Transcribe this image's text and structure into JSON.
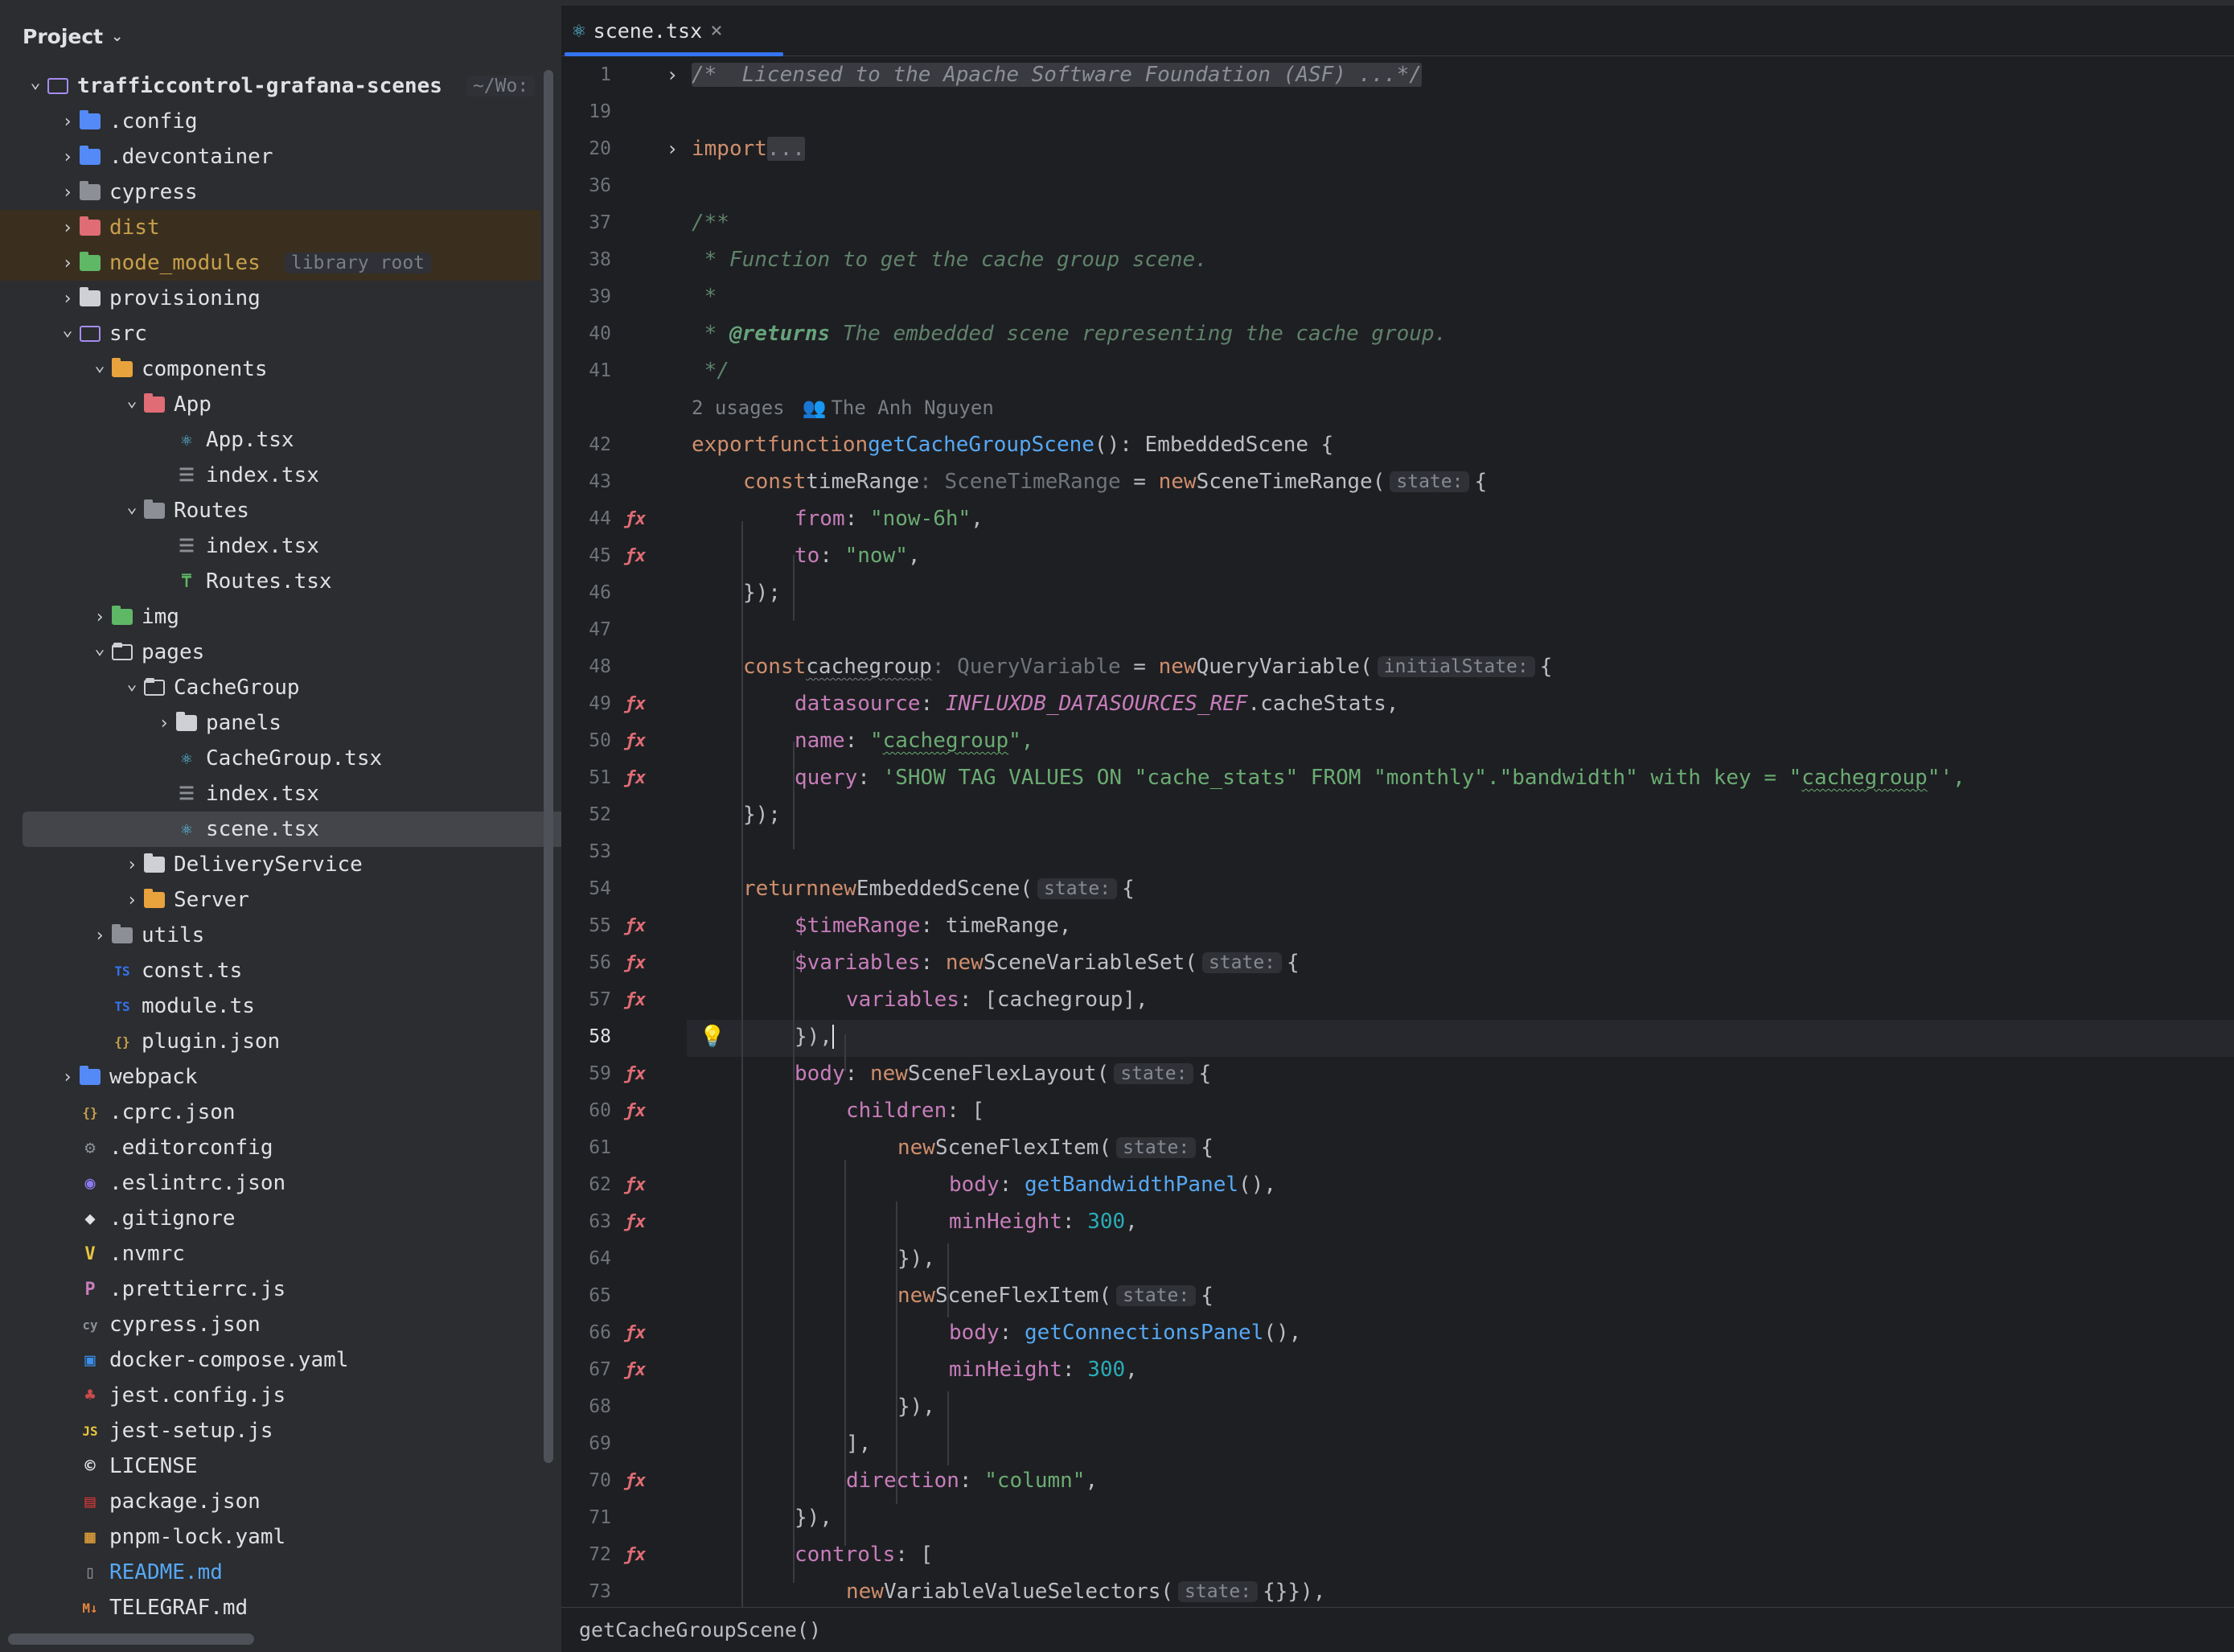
{
  "project_header": {
    "label": "Project"
  },
  "tree": [
    {
      "label": "trafficcontrol-grafana-scenes",
      "hint": "~/Wo:",
      "depth": 0,
      "expanded": true,
      "icon": "folder-outline-purple",
      "bold": true
    },
    {
      "label": ".config",
      "depth": 1,
      "expanded": false,
      "icon": "folder-blue-gear"
    },
    {
      "label": ".devcontainer",
      "depth": 1,
      "expanded": false,
      "icon": "folder-blue"
    },
    {
      "label": "cypress",
      "depth": 1,
      "expanded": false,
      "icon": "folder-gray"
    },
    {
      "label": "dist",
      "depth": 1,
      "expanded": false,
      "icon": "folder-red",
      "excluded": true
    },
    {
      "label": "node_modules",
      "hint": "library root",
      "depth": 1,
      "expanded": false,
      "icon": "folder-green",
      "excluded": true
    },
    {
      "label": "provisioning",
      "depth": 1,
      "expanded": false,
      "icon": "folder-white"
    },
    {
      "label": "src",
      "depth": 1,
      "expanded": true,
      "icon": "folder-source"
    },
    {
      "label": "components",
      "depth": 2,
      "expanded": true,
      "icon": "folder-orange"
    },
    {
      "label": "App",
      "depth": 3,
      "expanded": true,
      "icon": "folder-red"
    },
    {
      "label": "App.tsx",
      "depth": 4,
      "icon": "react-icon"
    },
    {
      "label": "index.tsx",
      "depth": 4,
      "icon": "index-icon"
    },
    {
      "label": "Routes",
      "depth": 3,
      "expanded": true,
      "icon": "folder-gray"
    },
    {
      "label": "index.tsx",
      "depth": 4,
      "icon": "index-icon"
    },
    {
      "label": "Routes.tsx",
      "depth": 4,
      "icon": "routes-icon"
    },
    {
      "label": "img",
      "depth": 2,
      "expanded": false,
      "icon": "folder-teal"
    },
    {
      "label": "pages",
      "depth": 2,
      "expanded": true,
      "icon": "folder-orange-outline"
    },
    {
      "label": "CacheGroup",
      "depth": 3,
      "expanded": true,
      "icon": "folder-outline"
    },
    {
      "label": "panels",
      "depth": 4,
      "expanded": false,
      "icon": "folder-white"
    },
    {
      "label": "CacheGroup.tsx",
      "depth": 4,
      "icon": "react-icon"
    },
    {
      "label": "index.tsx",
      "depth": 4,
      "icon": "index-icon"
    },
    {
      "label": "scene.tsx",
      "depth": 4,
      "icon": "react-icon",
      "selected": true
    },
    {
      "label": "DeliveryService",
      "depth": 3,
      "expanded": false,
      "icon": "folder-white"
    },
    {
      "label": "Server",
      "depth": 3,
      "expanded": false,
      "icon": "folder-orange"
    },
    {
      "label": "utils",
      "depth": 2,
      "expanded": false,
      "icon": "folder-gray"
    },
    {
      "label": "const.ts",
      "depth": 2,
      "icon": "ts-icon"
    },
    {
      "label": "module.ts",
      "depth": 2,
      "icon": "ts-icon"
    },
    {
      "label": "plugin.json",
      "depth": 2,
      "icon": "json-icon"
    },
    {
      "label": "webpack",
      "depth": 1,
      "expanded": false,
      "icon": "folder-blue"
    },
    {
      "label": ".cprc.json",
      "depth": 1,
      "icon": "json-icon"
    },
    {
      "label": ".editorconfig",
      "depth": 1,
      "icon": "editorconfig-icon"
    },
    {
      "label": ".eslintrc.json",
      "depth": 1,
      "icon": "eslint-icon"
    },
    {
      "label": ".gitignore",
      "depth": 1,
      "icon": "git-icon"
    },
    {
      "label": ".nvmrc",
      "depth": 1,
      "icon": "nvm-icon"
    },
    {
      "label": ".prettierrc.js",
      "depth": 1,
      "icon": "prettier-icon"
    },
    {
      "label": "cypress.json",
      "depth": 1,
      "icon": "cypress-icon"
    },
    {
      "label": "docker-compose.yaml",
      "depth": 1,
      "icon": "docker-icon"
    },
    {
      "label": "jest.config.js",
      "depth": 1,
      "icon": "jest-icon"
    },
    {
      "label": "jest-setup.js",
      "depth": 1,
      "icon": "js-icon"
    },
    {
      "label": "LICENSE",
      "depth": 1,
      "icon": "license-icon"
    },
    {
      "label": "package.json",
      "depth": 1,
      "icon": "npm-icon"
    },
    {
      "label": "pnpm-lock.yaml",
      "depth": 1,
      "icon": "pnpm-icon"
    },
    {
      "label": "README.md",
      "depth": 1,
      "icon": "readme-icon",
      "color": "#56a8f5"
    },
    {
      "label": "TELEGRAF.md",
      "depth": 1,
      "icon": "markdown-icon"
    }
  ],
  "editor_tab": {
    "label": "scene.tsx",
    "close": "×"
  },
  "breadcrumb": {
    "label": "getCacheGroupScene()"
  },
  "code": {
    "l1": "/*  Licensed to the Apache Software Foundation (ASF) ...*/",
    "l20_kw": "import",
    "l20_fold": "...",
    "l37": "/**",
    "l38": " * Function to get the cache group scene.",
    "l39": " *",
    "l40_a": " * ",
    "l40_tag": "@returns",
    "l40_b": " The embedded scene representing the cache group.",
    "l41": " */",
    "usages": "2 usages",
    "author": "The Anh Nguyen",
    "export": "export",
    "function": "function",
    "fn_name": "getCacheGroupScene",
    "fn_sig": "(): EmbeddedScene {",
    "const": "const",
    "timeRange": "timeRange",
    "SceneTimeRange_hint": ": SceneTimeRange",
    "eq": " = ",
    "new": "new",
    "SceneTimeRange": "SceneTimeRange(",
    "state_hint": "state:",
    "brace": "{",
    "from_key": "from",
    "from_val": "\"now-6h\"",
    "to_key": "to",
    "to_val": "\"now\"",
    "close_paren": "});",
    "cachegroup": "cachegroup",
    "QueryVariable_hint": ": QueryVariable",
    "QueryVariable": "QueryVariable(",
    "initialState_hint": "initialState:",
    "datasource_key": "datasource",
    "datasource_const": "INFLUXDB_DATASOURCES_REF",
    "datasource_rest": ".cacheStats,",
    "name_key": "name",
    "name_val_a": "\"",
    "name_val_b": "cachegroup",
    "name_val_c": "\",",
    "query_key": "query",
    "query_val_a": "'SHOW TAG VALUES ON \"cache_stats\" FROM \"monthly\".\"bandwidth\" with key = \"",
    "query_val_b": "cachegroup",
    "query_val_c": "\"',",
    "return": "return",
    "EmbeddedScene": "EmbeddedScene(",
    "timeRange_prop": "$timeRange",
    "timeRange_val": "timeRange,",
    "variables_prop": "$variables",
    "SceneVariableSet": "SceneVariableSet(",
    "variables_key": "variables",
    "variables_val": "[cachegroup],",
    "close_paren_comma": "}),",
    "body_key": "body",
    "SceneFlexLayout": "SceneFlexLayout(",
    "children_key": "children",
    "open_bracket": "[",
    "SceneFlexItem": "SceneFlexItem(",
    "getBandwidthPanel": "getBandwidthPanel",
    "call_comma": "(),",
    "minHeight_key": "minHeight",
    "minHeight_val": "300",
    "comma": ",",
    "getConnectionsPanel": "getConnectionsPanel",
    "close_bracket_comma": "],",
    "direction_key": "direction",
    "direction_val": "\"column\"",
    "controls_key": "controls",
    "VariableValueSelectors": "VariableValueSelectors(",
    "empty_obj": "{}",
    "close_call": "}),"
  },
  "line_numbers": [
    1,
    19,
    20,
    36,
    37,
    38,
    39,
    40,
    41,
    "",
    42,
    43,
    44,
    45,
    46,
    47,
    48,
    49,
    50,
    51,
    52,
    53,
    54,
    55,
    56,
    57,
    58,
    59,
    60,
    61,
    62,
    63,
    64,
    65,
    66,
    67,
    68,
    69,
    70,
    71,
    72,
    73
  ]
}
